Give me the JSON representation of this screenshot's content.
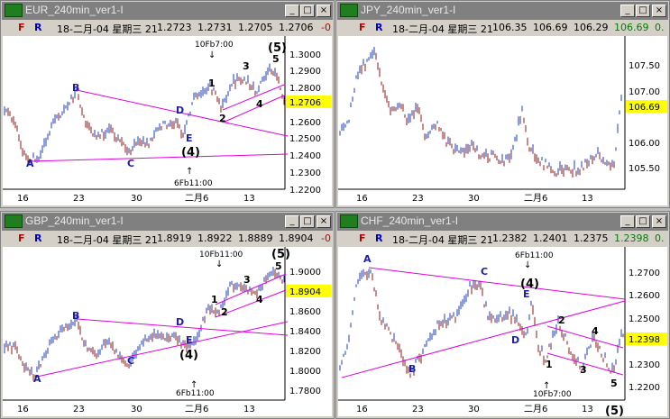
{
  "windows": [
    {
      "id": "eur",
      "title": "EUR_240min_ver1-I",
      "info": {
        "f": "F",
        "r": "R",
        "date": "18-二月-04 星期三 21",
        "open": "1.2723",
        "high": "1.2731",
        "low": "1.2705",
        "close": "1.2706",
        "change": "-0"
      },
      "price_label": "1.2706",
      "y_ticks": [
        "1.3000",
        "1.2900",
        "1.2800",
        "1.2700",
        "1.2600",
        "1.2500",
        "1.2400",
        "1.2300",
        "1.2200"
      ],
      "x_ticks": [
        "16",
        "23",
        "30",
        "二月6",
        "13"
      ],
      "wave_labels": {
        "A": "A",
        "B": "B",
        "C": "C",
        "D": "D",
        "E": "E",
        "four": "(4)",
        "five": "(5)",
        "s1": "1",
        "s2": "2",
        "s3": "3",
        "s4": "4",
        "s5": "5"
      },
      "annotations": {
        "top": "10Fb7:00",
        "bottom": "6Fb11:00"
      }
    },
    {
      "id": "jpy",
      "title": "JPY_240min_ver1-I",
      "info": {
        "f": "F",
        "r": "R",
        "date": "18-二月-04 星期三 21",
        "open": "106.35",
        "high": "106.69",
        "low": "106.29",
        "close": "106.69",
        "change": "0."
      },
      "price_label": "106.69",
      "y_ticks": [
        "107.50",
        "107.00",
        "106.50",
        "106.00",
        "105.50"
      ],
      "x_ticks": [
        "16",
        "23",
        "30",
        "二月6",
        "13"
      ]
    },
    {
      "id": "gbp",
      "title": "GBP_240min_ver1-I",
      "info": {
        "f": "F",
        "r": "R",
        "date": "18-二月-04 星期三 21",
        "open": "1.8919",
        "high": "1.8922",
        "low": "1.8889",
        "close": "1.8904",
        "change": "-0"
      },
      "price_label": "1.8904",
      "y_ticks": [
        "1.9000",
        "1.8800",
        "1.8600",
        "1.8400",
        "1.8200",
        "1.8000",
        "1.7800"
      ],
      "x_ticks": [
        "16",
        "23",
        "30",
        "二月6",
        "13"
      ],
      "wave_labels": {
        "A": "A",
        "B": "B",
        "C": "C",
        "D": "D",
        "E": "E",
        "four": "(4)",
        "five": "(5)",
        "s1": "1",
        "s2": "2",
        "s3": "3",
        "s4": "4",
        "s5": "5"
      },
      "annotations": {
        "top": "10Fb11:00",
        "bottom": "6Fb11:00"
      }
    },
    {
      "id": "chf",
      "title": "CHF_240min_ver1-I",
      "info": {
        "f": "F",
        "r": "R",
        "date": "18-二月-04 星期三 21",
        "open": "1.2382",
        "high": "1.2401",
        "low": "1.2375",
        "close": "1.2398",
        "change": "0."
      },
      "price_label": "1.2398",
      "y_ticks": [
        "1.2700",
        "1.2600",
        "1.2500",
        "1.2400",
        "1.2300",
        "1.2200"
      ],
      "x_ticks": [
        "16",
        "23",
        "30",
        "二月6",
        "13"
      ],
      "wave_labels": {
        "A": "A",
        "B": "B",
        "C": "C",
        "D": "D",
        "E": "E",
        "four": "(4)",
        "five": "(5)",
        "s1": "1",
        "s2": "2",
        "s3": "3",
        "s4": "4",
        "s5": "5"
      },
      "annotations": {
        "top": "6Fb11:00",
        "bottom": "10Fb7:00"
      }
    }
  ],
  "window_buttons": {
    "minimize": "_",
    "maximize": "□",
    "close": "×"
  },
  "colors": {
    "up": "#1e3cb4",
    "down": "#8b1a1a",
    "trendline": "#e000e0",
    "price_badge": "#ffff00"
  }
}
